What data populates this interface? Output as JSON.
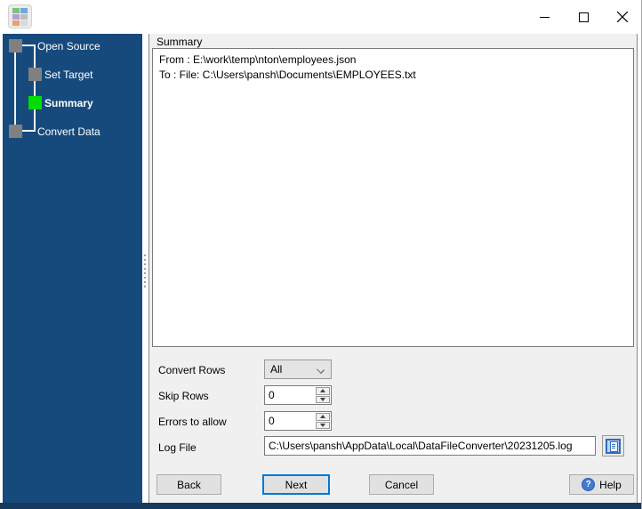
{
  "window": {
    "title": "",
    "controls": {
      "minimize": "minimize",
      "maximize": "maximize",
      "close": "close"
    }
  },
  "colors": {
    "sidebar_bg": "#164a7c",
    "active_step_green": "#00dd00",
    "inactive_step_gray": "#808080",
    "next_button_focus_blue": "#0078d7",
    "bottom_strip": "#17395e"
  },
  "sidebar": {
    "steps": [
      {
        "label": "Open Source",
        "state": "done"
      },
      {
        "label": "Set Target",
        "state": "done"
      },
      {
        "label": "Summary",
        "state": "active"
      },
      {
        "label": "Convert Data",
        "state": "pending"
      }
    ]
  },
  "main": {
    "section_label": "Summary",
    "summary_lines": {
      "0": "From : E:\\work\\temp\\nton\\employees.json",
      "1": "To : File: C:\\Users\\pansh\\Documents\\EMPLOYEES.txt"
    },
    "fields": {
      "convert_rows": {
        "label": "Convert Rows",
        "value": "All"
      },
      "skip_rows": {
        "label": "Skip Rows",
        "value": "0"
      },
      "errors_to_allow": {
        "label": "Errors to allow",
        "value": "0"
      },
      "log_file": {
        "label": "Log File",
        "value": "C:\\Users\\pansh\\AppData\\Local\\DataFileConverter\\20231205.log"
      }
    },
    "buttons": {
      "back": "Back",
      "next": "Next",
      "cancel": "Cancel",
      "help": "Help"
    }
  }
}
